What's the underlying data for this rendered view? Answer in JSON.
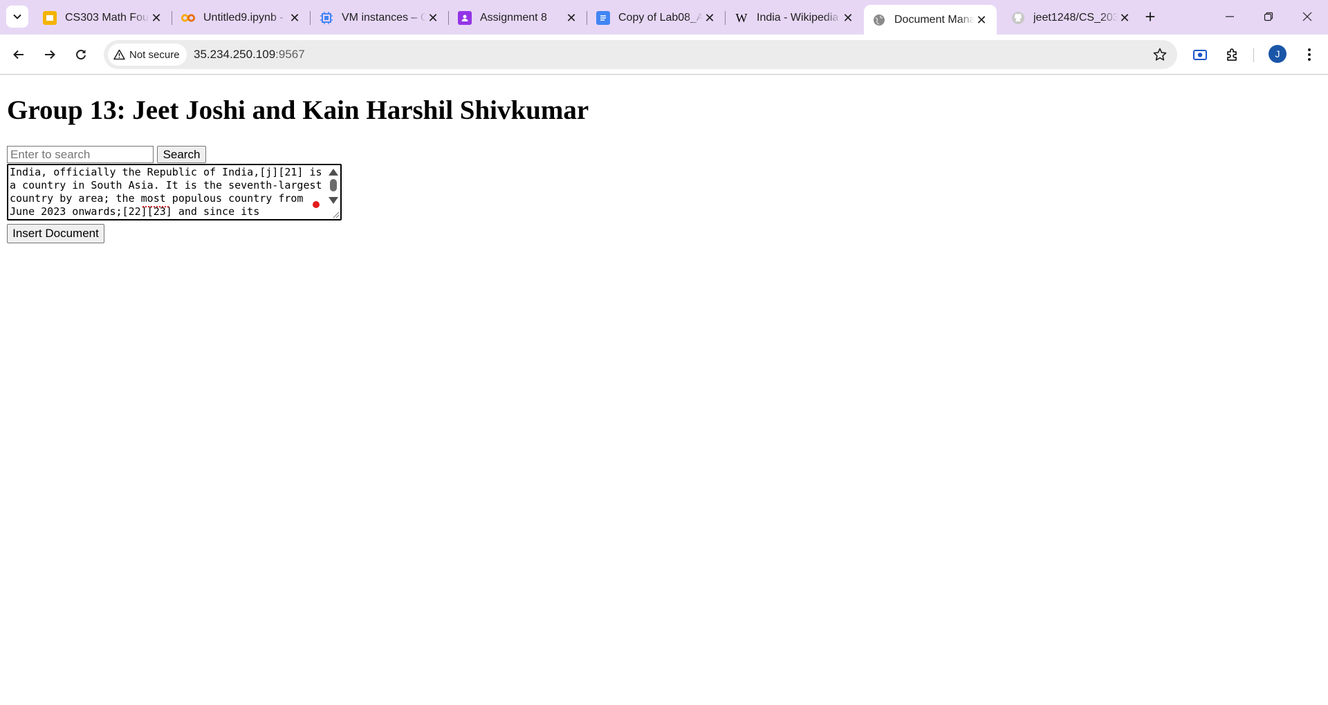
{
  "browser": {
    "tabs": [
      {
        "title": "CS303 Math Fou",
        "icon": "slides-icon",
        "color": "#f4b400",
        "active": false
      },
      {
        "title": "Untitled9.ipynb -",
        "icon": "colab-icon",
        "color": "#f9ab00",
        "active": false
      },
      {
        "title": "VM instances – C",
        "icon": "compute-engine-icon",
        "color": "#4285f4",
        "active": false
      },
      {
        "title": "Assignment 8",
        "icon": "classroom-icon",
        "color": "#9334e6",
        "active": false
      },
      {
        "title": "Copy of Lab08_A",
        "icon": "docs-icon",
        "color": "#4285f4",
        "active": false
      },
      {
        "title": "India - Wikipedia",
        "icon": "wikipedia-icon",
        "color": "#000000",
        "active": false
      },
      {
        "title": "Document Mana",
        "icon": "globe-icon",
        "color": "#6f6f6f",
        "active": true
      },
      {
        "title": "jeet1248/CS_203",
        "icon": "github-icon",
        "color": "#c8c8c8",
        "active": false
      }
    ],
    "security_label": "Not secure",
    "url_host": "35.234.250.109",
    "url_port": ":9567",
    "profile_initial": "J",
    "accent_color": "#e7d7f5"
  },
  "page": {
    "title": "Group 13: Jeet Joshi and Kain Harshil Shivkumar",
    "search": {
      "placeholder": "Enter to search",
      "button_label": "Search"
    },
    "document_text": "India, officially the Republic of India,[j][21] is a country in South Asia. It is the seventh-largest country by area; the most populous country from June 2023 onwards;[22][23] and since its",
    "insert_button_label": "Insert Document"
  }
}
